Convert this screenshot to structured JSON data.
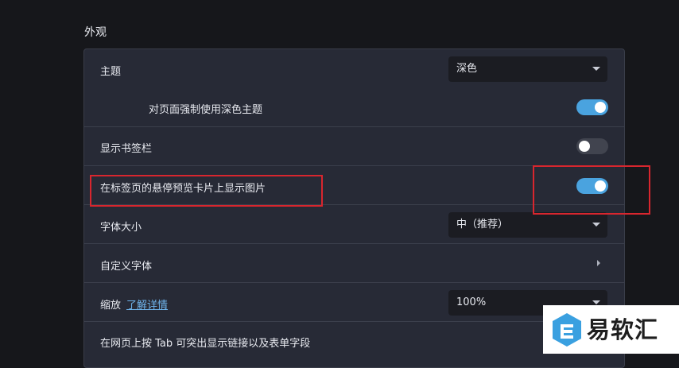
{
  "section_title": "外观",
  "rows": {
    "theme": {
      "label": "主题",
      "value": "深色"
    },
    "force_dark": {
      "label": "对页面强制使用深色主题",
      "enabled": true
    },
    "bookmarks_bar": {
      "label": "显示书签栏",
      "enabled": false
    },
    "tab_hover_images": {
      "label": "在标签页的悬停预览卡片上显示图片",
      "enabled": true
    },
    "font_size": {
      "label": "字体大小",
      "value": "中（推荐）"
    },
    "custom_fonts": {
      "label": "自定义字体"
    },
    "zoom": {
      "label": "缩放",
      "link": "了解详情",
      "value": "100%"
    },
    "tab_highlight": {
      "label": "在网页上按 Tab 可突出显示链接以及表单字段"
    }
  },
  "colors": {
    "accent": "#4aa3df",
    "highlight_box": "#d8262e",
    "card_bg": "#272a36"
  },
  "watermark": {
    "text": "易软汇",
    "icon": "yiruanhui-logo"
  }
}
